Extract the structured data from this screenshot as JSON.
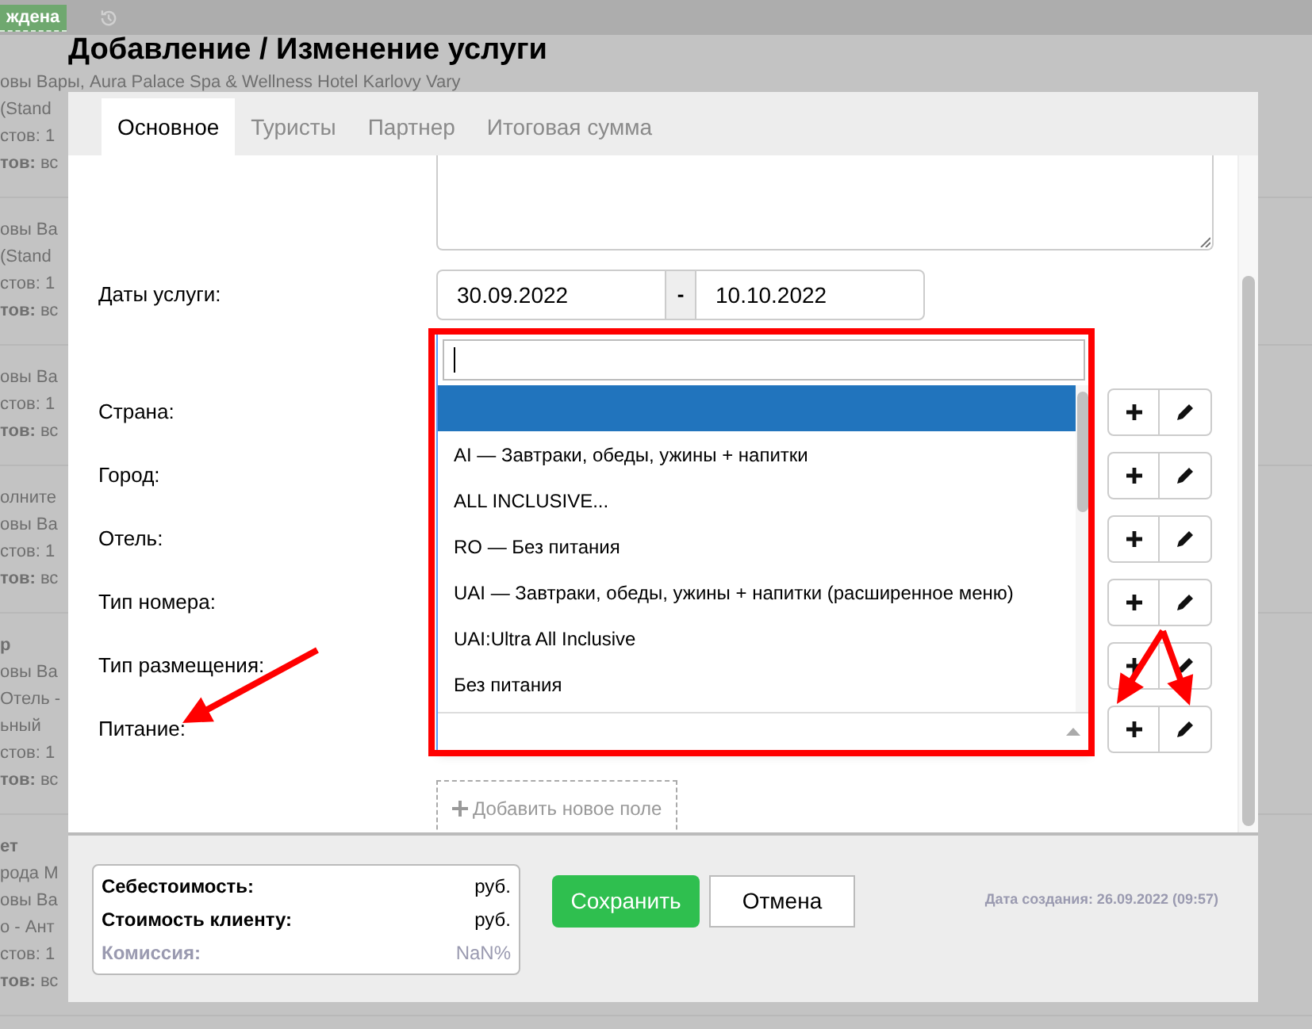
{
  "background_page": {
    "status_badge": "ждена",
    "groups": [
      {
        "lines": [
          {
            "kind": "line",
            "text": "овы Вары, Aura Palace Spa & Wellness Hotel Karlovy Vary"
          },
          {
            "kind": "line",
            "text": "(Stand"
          },
          {
            "kind": "line",
            "text": "стов: 1"
          },
          {
            "kind": "line",
            "text": "**тов:** вс"
          }
        ]
      },
      {
        "lines": [
          {
            "kind": "line",
            "text": "овы Ва"
          },
          {
            "kind": "line",
            "text": "(Stand"
          },
          {
            "kind": "line",
            "text": "стов: 1"
          },
          {
            "kind": "line",
            "text": "**тов:** вс"
          }
        ]
      },
      {
        "lines": [
          {
            "kind": "line",
            "text": "овы Ва"
          },
          {
            "kind": "line",
            "text": "стов: 1"
          },
          {
            "kind": "line",
            "text": "**тов:** вс"
          }
        ]
      },
      {
        "lines": [
          {
            "kind": "line",
            "text": "олните"
          },
          {
            "kind": "line",
            "text": "овы Ва"
          },
          {
            "kind": "line",
            "text": "стов: 1"
          },
          {
            "kind": "line",
            "text": "**тов:** вс"
          }
        ]
      },
      {
        "lines": [
          {
            "kind": "heading",
            "text": "р"
          },
          {
            "kind": "line",
            "text": "овы Ва"
          },
          {
            "kind": "line",
            "text": "Отель -"
          },
          {
            "kind": "line",
            "text": "ьный"
          },
          {
            "kind": "line",
            "text": "стов: 1"
          },
          {
            "kind": "line",
            "text": "**тов:** вс"
          }
        ]
      },
      {
        "lines": [
          {
            "kind": "heading",
            "text": "ет"
          },
          {
            "kind": "line",
            "text": "рода М"
          },
          {
            "kind": "line",
            "text": "овы Ва"
          },
          {
            "kind": "line",
            "text": "о - Ант"
          },
          {
            "kind": "line",
            "text": "стов: 1"
          },
          {
            "kind": "line",
            "text": "**тов:** вс"
          }
        ]
      }
    ]
  },
  "dialog": {
    "title": "Добавление / Изменение услуги",
    "tabs": [
      {
        "label": "Основное",
        "selected": true
      },
      {
        "label": "Туристы",
        "selected": false
      },
      {
        "label": "Партнер",
        "selected": false
      },
      {
        "label": "Итоговая сумма",
        "selected": false
      }
    ],
    "dates": {
      "label": "Даты услуги:",
      "from": "30.09.2022",
      "separator": "-",
      "to": "10.10.2022"
    },
    "select_fields": [
      {
        "label": "Страна:",
        "open": false
      },
      {
        "label": "Город:",
        "open": false
      },
      {
        "label": "Отель:",
        "open": false
      },
      {
        "label": "Тип номера:",
        "open": false
      },
      {
        "label": "Тип размещения:",
        "open": false
      },
      {
        "label": "Питание:",
        "open": true
      }
    ],
    "dropdown_options": [
      {
        "selected": true
      },
      {
        "text": "AI — Завтраки, обеды, ужины + напитки",
        "selected": false
      },
      {
        "text": "ALL INCLUSIVE...",
        "selected": false
      },
      {
        "text": "RO — Без питания",
        "selected": false
      },
      {
        "text": "UAI — Завтраки, обеды, ужины + напитки (расширенное меню)",
        "selected": false
      },
      {
        "text": "UAI:Ultra All Inclusive",
        "selected": false
      },
      {
        "text": "Без питания",
        "selected": false
      }
    ],
    "add_field_button": "Добавить новое поле",
    "summary": [
      {
        "label": "Себестоимость:",
        "value": "руб.",
        "muted": false
      },
      {
        "label": "Стоимость клиенту:",
        "value": "руб.",
        "muted": false
      },
      {
        "label": "Комиссия:",
        "value": "NaN%",
        "muted": true
      }
    ],
    "save_button": "Сохранить",
    "cancel_button": "Отмена",
    "created": "Дата создания: 26.09.2022 (09:57)"
  }
}
